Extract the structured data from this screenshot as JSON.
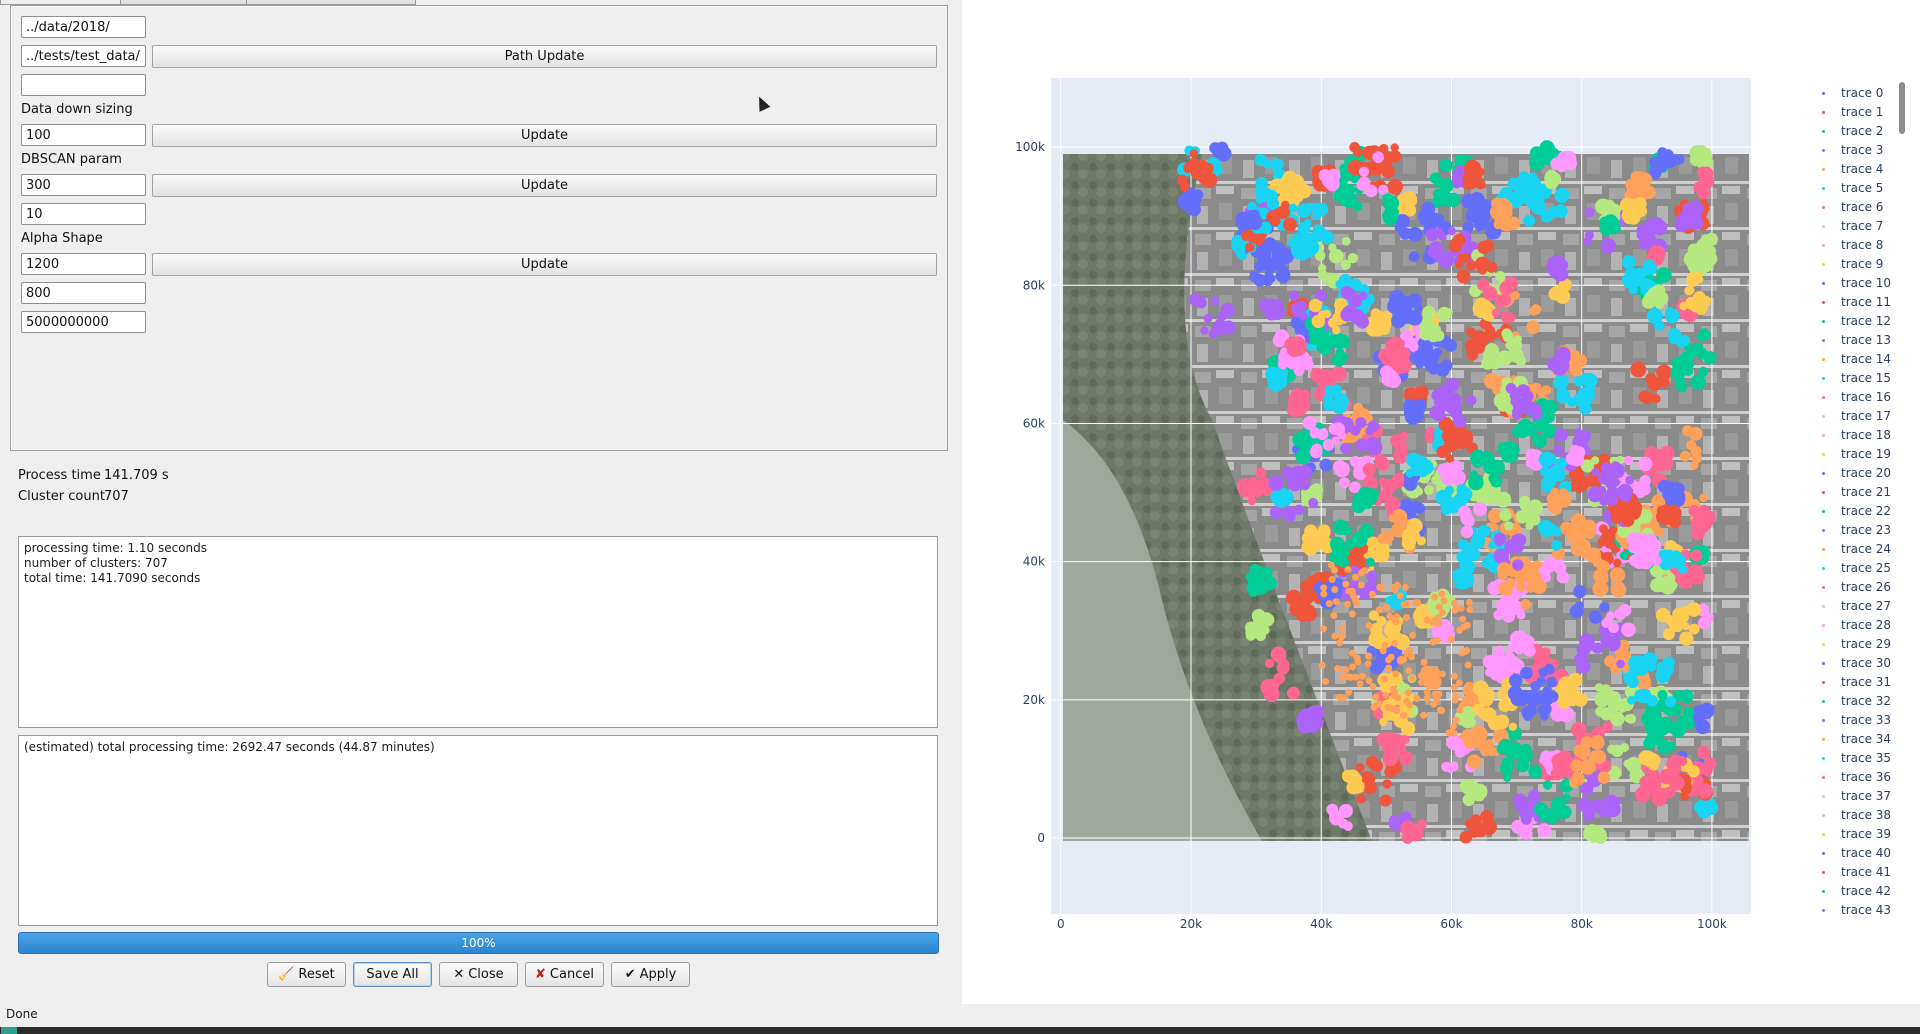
{
  "params": {
    "path_input_1": "../data/2018/",
    "path_input_2": "../tests/test_data/",
    "path_input_3": "",
    "path_update_button": "Path Update",
    "downsizing_label": "Data down sizing",
    "downsizing_value": "100",
    "downsizing_update_button": "Update",
    "dbscan_label": "DBSCAN param",
    "dbscan_value_1": "300",
    "dbscan_update_button": "Update",
    "dbscan_value_2": "10",
    "alpha_label": "Alpha Shape",
    "alpha_value_1": "1200",
    "alpha_update_button": "Update",
    "alpha_value_2": "800",
    "alpha_value_3": "5000000000"
  },
  "results": {
    "process_time_label": "Process time",
    "process_time_value": "141.709 s",
    "cluster_count_label": "Cluster count",
    "cluster_count_value": "707"
  },
  "log1": "processing time: 1.10 seconds\nnumber of clusters: 707\ntotal time: 141.7090 seconds",
  "log2": "(estimated) total processing time: 2692.47 seconds (44.87 minutes)",
  "progress": {
    "label": "100%",
    "fraction": 1.0
  },
  "buttons": {
    "reset": "Reset",
    "save_all": "Save All",
    "close": "Close",
    "cancel": "Cancel",
    "apply": "Apply"
  },
  "icons": {
    "reset": "broom-icon",
    "close": "x-icon",
    "cancel": "x-icon",
    "apply": "check-icon"
  },
  "status": "Done",
  "chart_data": {
    "type": "scatter",
    "title": "",
    "xlabel": "",
    "ylabel": "",
    "xlim": [
      -1500,
      106000
    ],
    "ylim": [
      -11000,
      110000
    ],
    "x_ticks": [
      "0",
      "20k",
      "40k",
      "60k",
      "80k",
      "100k"
    ],
    "x_tick_values": [
      0,
      20000,
      40000,
      60000,
      80000,
      100000
    ],
    "y_ticks": [
      "0",
      "20k",
      "40k",
      "60k",
      "80k",
      "100k"
    ],
    "y_tick_values": [
      0,
      20000,
      40000,
      60000,
      80000,
      100000
    ],
    "background_image_extent": [
      0,
      100000,
      0,
      100000
    ],
    "grid": true,
    "legend_position": "right",
    "palette": [
      "#636efa",
      "#ef553b",
      "#00cc96",
      "#ab63fa",
      "#ffa15a",
      "#19d3f3",
      "#ff6692",
      "#b6e880",
      "#ff97ff",
      "#fecb52"
    ],
    "series": [
      {
        "name": "trace 0"
      },
      {
        "name": "trace 1"
      },
      {
        "name": "trace 2"
      },
      {
        "name": "trace 3"
      },
      {
        "name": "trace 4"
      },
      {
        "name": "trace 5"
      },
      {
        "name": "trace 6"
      },
      {
        "name": "trace 7"
      },
      {
        "name": "trace 8"
      },
      {
        "name": "trace 9"
      },
      {
        "name": "trace 10"
      },
      {
        "name": "trace 11"
      },
      {
        "name": "trace 12"
      },
      {
        "name": "trace 13"
      },
      {
        "name": "trace 14"
      },
      {
        "name": "trace 15"
      },
      {
        "name": "trace 16"
      },
      {
        "name": "trace 17"
      },
      {
        "name": "trace 18"
      },
      {
        "name": "trace 19"
      },
      {
        "name": "trace 20"
      },
      {
        "name": "trace 21"
      },
      {
        "name": "trace 22"
      },
      {
        "name": "trace 23"
      },
      {
        "name": "trace 24"
      },
      {
        "name": "trace 25"
      },
      {
        "name": "trace 26"
      },
      {
        "name": "trace 27"
      },
      {
        "name": "trace 28"
      },
      {
        "name": "trace 29"
      },
      {
        "name": "trace 30"
      },
      {
        "name": "trace 31"
      },
      {
        "name": "trace 32"
      },
      {
        "name": "trace 33"
      },
      {
        "name": "trace 34"
      },
      {
        "name": "trace 35"
      },
      {
        "name": "trace 36"
      },
      {
        "name": "trace 37"
      },
      {
        "name": "trace 38"
      },
      {
        "name": "trace 39"
      },
      {
        "name": "trace 40"
      },
      {
        "name": "trace 41"
      },
      {
        "name": "trace 42"
      },
      {
        "name": "trace 43"
      }
    ]
  }
}
